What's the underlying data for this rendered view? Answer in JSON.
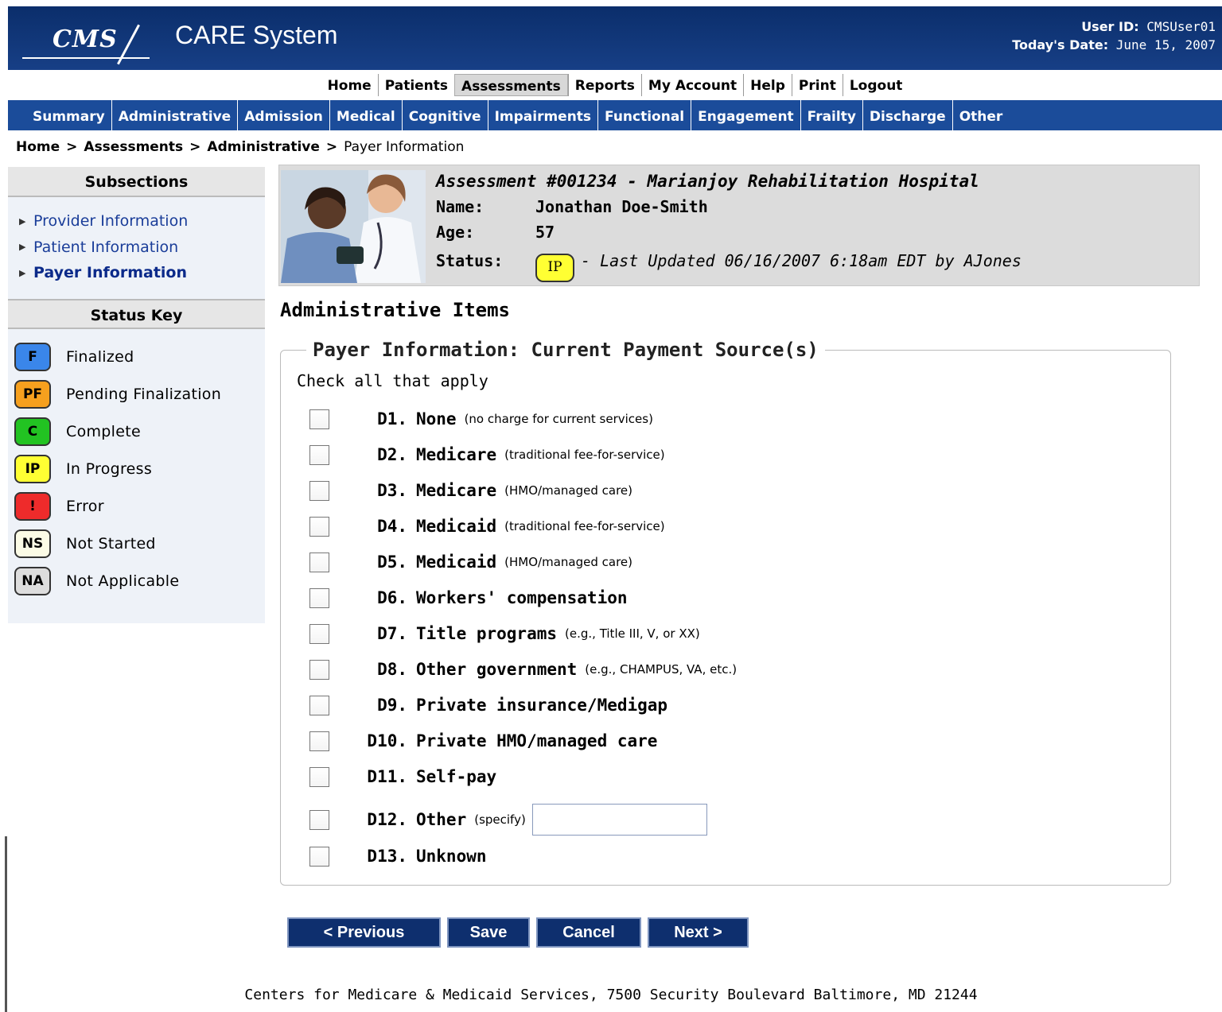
{
  "header": {
    "logo_text": "CMS",
    "app_title": "CARE System",
    "user_id_label": "User ID:",
    "user_id": "CMSUser01",
    "date_label": "Today's Date:",
    "date": "June 15, 2007"
  },
  "top_nav": [
    "Home",
    "Patients",
    "Assessments",
    "Reports",
    "My Account",
    "Help",
    "Print",
    "Logout"
  ],
  "top_nav_active": "Assessments",
  "section_nav": [
    "Summary",
    "Administrative",
    "Admission",
    "Medical",
    "Cognitive",
    "Impairments",
    "Functional",
    "Engagement",
    "Frailty",
    "Discharge",
    "Other"
  ],
  "breadcrumb": {
    "items": [
      "Home",
      "Assessments",
      "Administrative"
    ],
    "current": "Payer Information",
    "separator": ">"
  },
  "sidebar": {
    "subsections_title": "Subsections",
    "subsections": [
      "Provider Information",
      "Patient Information",
      "Payer Information"
    ],
    "current_subsection": "Payer Information",
    "status_key_title": "Status Key",
    "status_key": [
      {
        "code": "F",
        "label": "Finalized",
        "color": "#3a86ea"
      },
      {
        "code": "PF",
        "label": "Pending Finalization",
        "color": "#f6a01e"
      },
      {
        "code": "C",
        "label": "Complete",
        "color": "#22c322"
      },
      {
        "code": "IP",
        "label": "In Progress",
        "color": "#ffff33"
      },
      {
        "code": "!",
        "label": "Error",
        "color": "#ee2b2b"
      },
      {
        "code": "NS",
        "label": "Not Started",
        "color": "#fbfbe6"
      },
      {
        "code": "NA",
        "label": "Not Applicable",
        "color": "#dddddd"
      }
    ]
  },
  "assessment": {
    "title": "Assessment #001234 - Marianjoy Rehabilitation Hospital",
    "name_label": "Name:",
    "name": "Jonathan Doe-Smith",
    "age_label": "Age:",
    "age": "57",
    "status_label": "Status:",
    "status_code": "IP",
    "last_updated": "- Last Updated 06/16/2007 6:18am EDT by AJones"
  },
  "page_title": "Administrative Items",
  "form": {
    "legend": "Payer Information: Current Payment Source(s)",
    "instruction": "Check all that apply",
    "items": [
      {
        "code": "D1.",
        "label": "None",
        "note": "(no charge for current services)"
      },
      {
        "code": "D2.",
        "label": "Medicare",
        "note": "(traditional fee-for-service)"
      },
      {
        "code": "D3.",
        "label": "Medicare",
        "note": "(HMO/managed care)"
      },
      {
        "code": "D4.",
        "label": "Medicaid",
        "note": "(traditional fee-for-service)"
      },
      {
        "code": "D5.",
        "label": "Medicaid",
        "note": "(HMO/managed care)"
      },
      {
        "code": "D6.",
        "label": "Workers' compensation",
        "note": ""
      },
      {
        "code": "D7.",
        "label": "Title programs",
        "note": "(e.g., Title III, V, or XX)"
      },
      {
        "code": "D8.",
        "label": "Other government",
        "note": "(e.g., CHAMPUS, VA, etc.)"
      },
      {
        "code": "D9.",
        "label": "Private insurance/Medigap",
        "note": ""
      },
      {
        "code": "D10.",
        "label": "Private HMO/managed care",
        "note": ""
      },
      {
        "code": "D11.",
        "label": "Self-pay",
        "note": ""
      },
      {
        "code": "D12.",
        "label": "Other",
        "note": "(specify)"
      },
      {
        "code": "D13.",
        "label": "Unknown",
        "note": ""
      }
    ],
    "specify_value": ""
  },
  "buttons": {
    "previous": "< Previous",
    "save": "Save",
    "cancel": "Cancel",
    "next": "Next >"
  },
  "footer": "Centers for Medicare & Medicaid Services, 7500 Security Boulevard Baltimore, MD 21244"
}
